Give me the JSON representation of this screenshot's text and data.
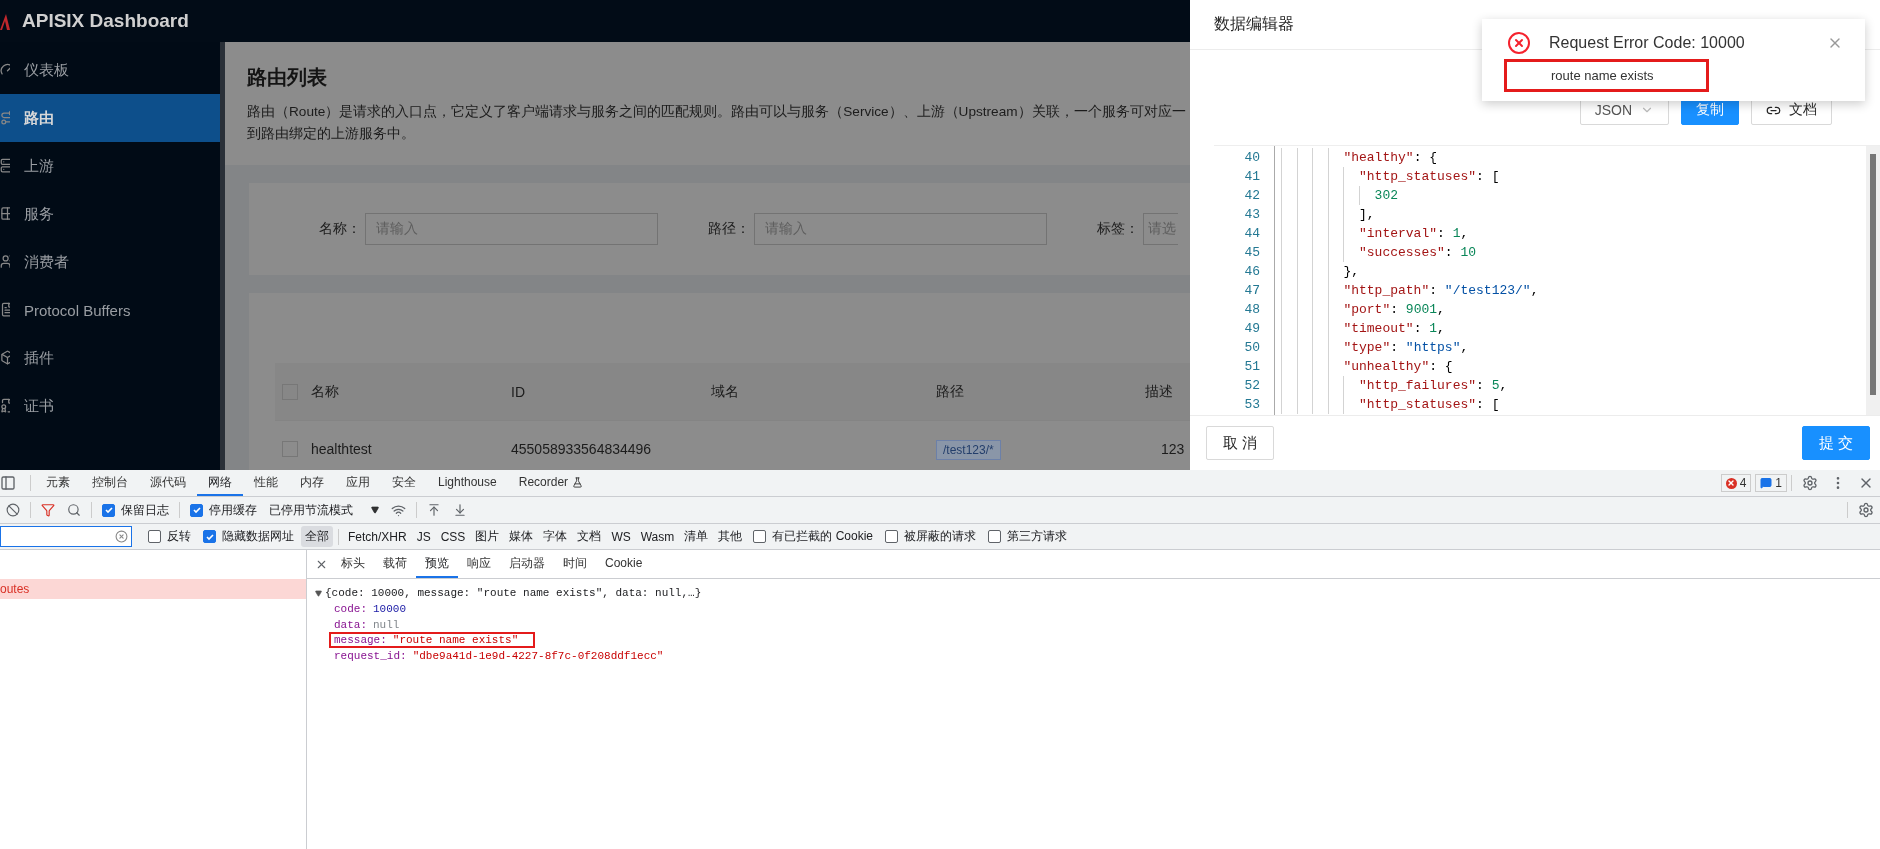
{
  "app": {
    "title": "APISIX Dashboard"
  },
  "sidebar": {
    "items": [
      {
        "label": "仪表板",
        "selected": false
      },
      {
        "label": "路由",
        "selected": true
      },
      {
        "label": "上游",
        "selected": false
      },
      {
        "label": "服务",
        "selected": false
      },
      {
        "label": "消费者",
        "selected": false
      },
      {
        "label": "Protocol Buffers",
        "selected": false
      },
      {
        "label": "插件",
        "selected": false
      },
      {
        "label": "证书",
        "selected": false
      }
    ]
  },
  "page": {
    "title": "路由列表",
    "description_lines": [
      "路由（Route）是请求的入口点，它定义了客户端请求与服务之间的匹配规则。路由可以与服务（Service）、上游（Upstream）关联，一个服务可对应一",
      "到路由绑定的上游服务中。"
    ]
  },
  "filters": [
    {
      "label": "名称：",
      "placeholder": "请输入"
    },
    {
      "label": "路径：",
      "placeholder": "请输入"
    },
    {
      "label": "标签：",
      "placeholder": "请选"
    }
  ],
  "table": {
    "header_checked": false,
    "columns": [
      "名称",
      "ID",
      "域名",
      "路径",
      "描述"
    ],
    "rows": [
      {
        "checked": false,
        "name": "healthtest",
        "id": "455058933564834496",
        "path": "/test123/*",
        "description": "123"
      }
    ]
  },
  "drawer": {
    "title": "数据编辑器",
    "format": "JSON",
    "copy_label": "复制",
    "docs_label": "文档",
    "cancel_label": "取 消",
    "submit_label": "提 交",
    "code_lines": [
      {
        "number": "40",
        "tokens": [
          {
            "kind": "key",
            "text": "        \"healthy\""
          },
          {
            "kind": "punct",
            "text": ": {"
          }
        ]
      },
      {
        "number": "41",
        "tokens": [
          {
            "kind": "key",
            "text": "          \"http_statuses\""
          },
          {
            "kind": "punct",
            "text": ": ["
          }
        ]
      },
      {
        "number": "42",
        "tokens": [
          {
            "kind": "number",
            "text": "            302"
          }
        ]
      },
      {
        "number": "43",
        "tokens": [
          {
            "kind": "punct",
            "text": "          ],"
          }
        ]
      },
      {
        "number": "44",
        "tokens": [
          {
            "kind": "key",
            "text": "          \"interval\""
          },
          {
            "kind": "punct",
            "text": ": "
          },
          {
            "kind": "number",
            "text": "1"
          },
          {
            "kind": "punct",
            "text": ","
          }
        ]
      },
      {
        "number": "45",
        "tokens": [
          {
            "kind": "key",
            "text": "          \"successes\""
          },
          {
            "kind": "punct",
            "text": ": "
          },
          {
            "kind": "number",
            "text": "10"
          }
        ]
      },
      {
        "number": "46",
        "tokens": [
          {
            "kind": "punct",
            "text": "        },"
          }
        ]
      },
      {
        "number": "47",
        "tokens": [
          {
            "kind": "key",
            "text": "        \"http_path\""
          },
          {
            "kind": "punct",
            "text": ": "
          },
          {
            "kind": "string",
            "text": "\"/test123/\""
          },
          {
            "kind": "punct",
            "text": ","
          }
        ]
      },
      {
        "number": "48",
        "tokens": [
          {
            "kind": "key",
            "text": "        \"port\""
          },
          {
            "kind": "punct",
            "text": ": "
          },
          {
            "kind": "number",
            "text": "9001"
          },
          {
            "kind": "punct",
            "text": ","
          }
        ]
      },
      {
        "number": "49",
        "tokens": [
          {
            "kind": "key",
            "text": "        \"timeout\""
          },
          {
            "kind": "punct",
            "text": ": "
          },
          {
            "kind": "number",
            "text": "1"
          },
          {
            "kind": "punct",
            "text": ","
          }
        ]
      },
      {
        "number": "50",
        "tokens": [
          {
            "kind": "key",
            "text": "        \"type\""
          },
          {
            "kind": "punct",
            "text": ": "
          },
          {
            "kind": "string",
            "text": "\"https\""
          },
          {
            "kind": "punct",
            "text": ","
          }
        ]
      },
      {
        "number": "51",
        "tokens": [
          {
            "kind": "key",
            "text": "        \"unhealthy\""
          },
          {
            "kind": "punct",
            "text": ": {"
          }
        ]
      },
      {
        "number": "52",
        "tokens": [
          {
            "kind": "key",
            "text": "          \"http_failures\""
          },
          {
            "kind": "punct",
            "text": ": "
          },
          {
            "kind": "number",
            "text": "5"
          },
          {
            "kind": "punct",
            "text": ","
          }
        ]
      },
      {
        "number": "53",
        "tokens": [
          {
            "kind": "key",
            "text": "          \"http_statuses\""
          },
          {
            "kind": "punct",
            "text": ": ["
          }
        ]
      }
    ]
  },
  "toast": {
    "title": "Request Error Code: 10000",
    "message": "route name exists",
    "highlighted": true
  },
  "devtools": {
    "tabs": [
      {
        "label": "元素",
        "selected": false
      },
      {
        "label": "控制台",
        "selected": false
      },
      {
        "label": "源代码",
        "selected": false
      },
      {
        "label": "网络",
        "selected": true
      },
      {
        "label": "性能",
        "selected": false
      },
      {
        "label": "内存",
        "selected": false
      },
      {
        "label": "应用",
        "selected": false
      },
      {
        "label": "安全",
        "selected": false
      },
      {
        "label": "Lighthouse",
        "selected": false
      },
      {
        "label": "Recorder",
        "selected": false
      }
    ],
    "error_count": "4",
    "message_count": "1",
    "toolbar": {
      "filter_active": true,
      "preserve_log": {
        "label": "保留日志",
        "checked": true
      },
      "disable_cache": {
        "label": "停用缓存",
        "checked": true
      },
      "throttling": "已停用节流模式"
    },
    "filter_bar": {
      "invert": {
        "label": "反转",
        "checked": false
      },
      "hide_data_urls": {
        "label": "隐藏数据网址",
        "checked": true
      },
      "types": [
        {
          "label": "全部",
          "selected": true
        },
        {
          "label": "Fetch/XHR",
          "selected": false
        },
        {
          "label": "JS",
          "selected": false
        },
        {
          "label": "CSS",
          "selected": false
        },
        {
          "label": "图片",
          "selected": false
        },
        {
          "label": "媒体",
          "selected": false
        },
        {
          "label": "字体",
          "selected": false
        },
        {
          "label": "文档",
          "selected": false
        },
        {
          "label": "WS",
          "selected": false
        },
        {
          "label": "Wasm",
          "selected": false
        },
        {
          "label": "清单",
          "selected": false
        },
        {
          "label": "其他",
          "selected": false
        }
      ],
      "options": [
        {
          "label": "有已拦截的 Cookie",
          "checked": false
        },
        {
          "label": "被屏蔽的请求",
          "checked": false
        },
        {
          "label": "第三方请求",
          "checked": false
        }
      ]
    },
    "requests": [
      {
        "name": "outes",
        "failed": true
      }
    ],
    "detail_tabs": [
      {
        "label": "标头",
        "selected": false
      },
      {
        "label": "载荷",
        "selected": false
      },
      {
        "label": "预览",
        "selected": true
      },
      {
        "label": "响应",
        "selected": false
      },
      {
        "label": "启动器",
        "selected": false
      },
      {
        "label": "时间",
        "selected": false
      },
      {
        "label": "Cookie",
        "selected": false
      }
    ],
    "preview": {
      "expanded": true,
      "summary": "{code: 10000, message: \"route name exists\", data: null,…}",
      "fields": [
        {
          "key": "code:",
          "value": "10000",
          "kind": "number",
          "highlighted": false
        },
        {
          "key": "data:",
          "value": "null",
          "kind": "null",
          "highlighted": false
        },
        {
          "key": "message:",
          "value": "\"route name exists\"",
          "kind": "string",
          "highlighted": true
        },
        {
          "key": "request_id:",
          "value": "\"dbe9a41d-1e9d-4227-8f7c-0f208ddf1ecc\"",
          "kind": "string",
          "highlighted": false
        }
      ]
    }
  }
}
